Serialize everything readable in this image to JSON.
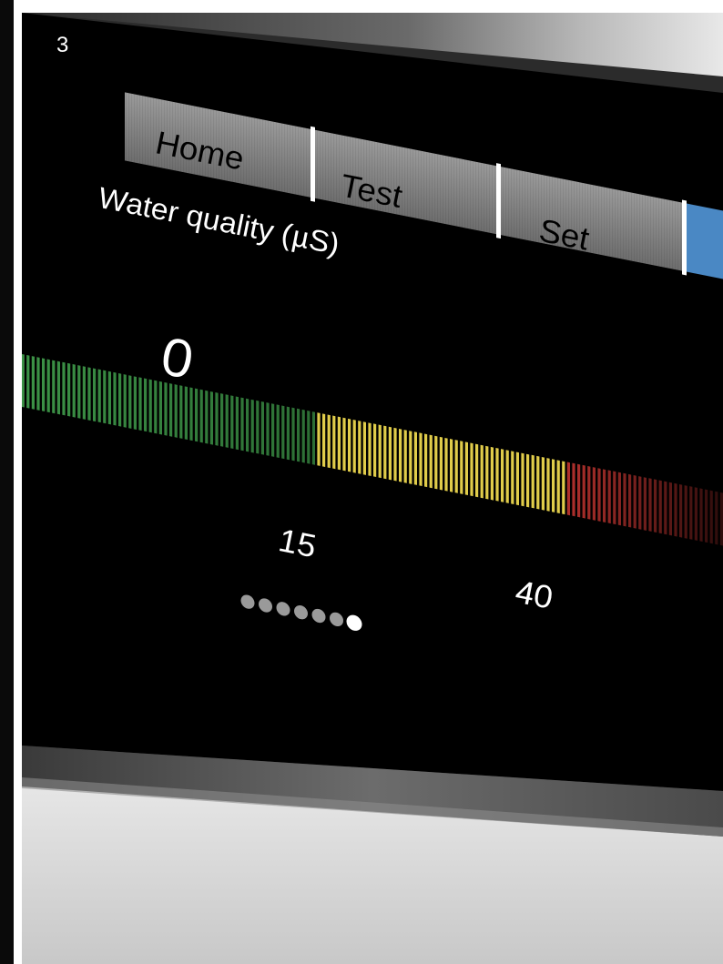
{
  "page_number": "3",
  "tabs": [
    {
      "label": "Home"
    },
    {
      "label": "Test"
    },
    {
      "label": "Set"
    }
  ],
  "display": {
    "title": "Water quality (µS)",
    "value": "0",
    "scale_labels": [
      "15",
      "40"
    ]
  },
  "page_indicator": {
    "dots": 7,
    "active_index": 6
  },
  "colors": {
    "screen": "#000000",
    "tab_gray": "#7d7d7d",
    "tab_blue": "#4a88c4",
    "bar_green": "#3f9a4a",
    "bar_yellow": "#e0cc4a",
    "bar_red": "#b0302c",
    "bezel_light": "#d0d0d0"
  }
}
